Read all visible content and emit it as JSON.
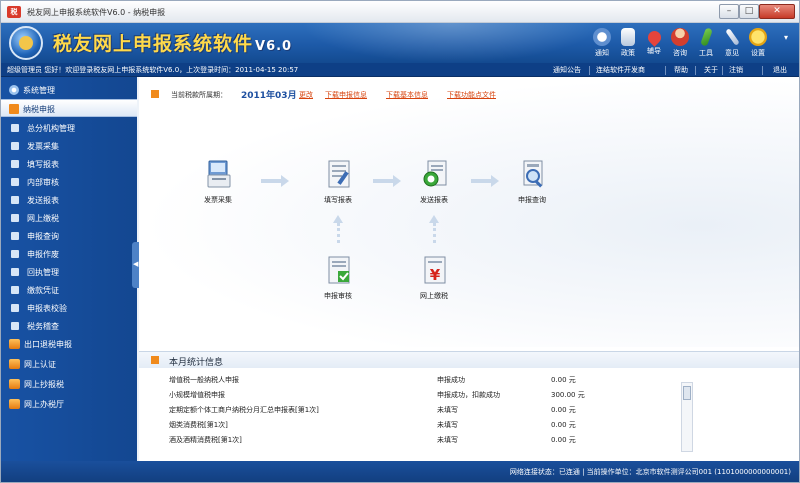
{
  "titlebar": {
    "title": "税友网上申报系统软件V6.0 - 纳税申报",
    "app_icon_text": "税"
  },
  "banner": {
    "app_name": "税友网上申报系统软件",
    "version": "V6.0",
    "tools": [
      {
        "label": "通知",
        "icon": "bell-icon"
      },
      {
        "label": "政策",
        "icon": "document-icon"
      },
      {
        "label": "辅导",
        "icon": "heart-icon"
      },
      {
        "label": "咨询",
        "icon": "person-icon"
      },
      {
        "label": "工具",
        "icon": "wrench-icon"
      },
      {
        "label": "意见",
        "icon": "pen-icon"
      },
      {
        "label": "设置",
        "icon": "bee-icon"
      }
    ],
    "more": "▾"
  },
  "userbar": {
    "text": "超级管理员 您好！欢迎登录税友网上申报系统软件V6.0，上次登录时间：2011-04-15 20:57",
    "links": [
      "通知公告",
      "连结软件开发商",
      "帮助",
      "关于",
      "注销",
      "退出"
    ]
  },
  "sidebar": {
    "items": [
      {
        "label": "系统管理",
        "style": "top"
      },
      {
        "label": "纳税申报",
        "style": "active"
      },
      {
        "label": "总分机构管理",
        "style": "sub"
      },
      {
        "label": "发票采集",
        "style": "sub"
      },
      {
        "label": "填写报表",
        "style": "sub"
      },
      {
        "label": "内部审核",
        "style": "sub"
      },
      {
        "label": "发送报表",
        "style": "sub"
      },
      {
        "label": "网上缴税",
        "style": "sub"
      },
      {
        "label": "申报查询",
        "style": "sub"
      },
      {
        "label": "申报作废",
        "style": "sub"
      },
      {
        "label": "回执管理",
        "style": "sub"
      },
      {
        "label": "缴款凭证",
        "style": "sub"
      },
      {
        "label": "申报表校验",
        "style": "sub"
      },
      {
        "label": "税务稽查",
        "style": "sub"
      },
      {
        "label": "出口退税申报",
        "style": "orange"
      },
      {
        "label": "网上认证",
        "style": "orange"
      },
      {
        "label": "网上抄报税",
        "style": "orange"
      },
      {
        "label": "网上办税厅",
        "style": "orange"
      }
    ],
    "collapse_glyph": "◀"
  },
  "period": {
    "label": "当前税款所属期：",
    "value": "2011年03月",
    "links": [
      "更改",
      "下载申报信息",
      "下载基本信息",
      "下载功能点文件"
    ]
  },
  "flow": {
    "invoice": "发票采集",
    "fill": "填写报表",
    "send": "发送报表",
    "query": "申报查询",
    "audit": "申报审核",
    "pay": "网上缴税"
  },
  "stats": {
    "title": "本月统计信息",
    "rows": [
      {
        "name": "增值税一般纳税人申报",
        "status": "申报成功",
        "amount": "0.00 元"
      },
      {
        "name": "小规模增值税申报",
        "status": "申报成功，扣款成功",
        "amount": "300.00 元"
      },
      {
        "name": "定期定额个体工商户纳税分月汇总申报表[第1次]",
        "status": "未填写",
        "amount": "0.00 元"
      },
      {
        "name": "烟类消费税[第1次]",
        "status": "未填写",
        "amount": "0.00 元"
      },
      {
        "name": "酒及酒精消费税[第1次]",
        "status": "未填写",
        "amount": "0.00 元"
      }
    ]
  },
  "statusbar": {
    "text": "网络连接状态：已连通  |  当前操作单位：北京市软件测评公司001 (1101000000000001)"
  },
  "colors": {
    "banner": "#1d5aa8",
    "sidebar": "#1852a4",
    "accent_orange": "#f08a1c",
    "link_red": "#d7430d"
  }
}
